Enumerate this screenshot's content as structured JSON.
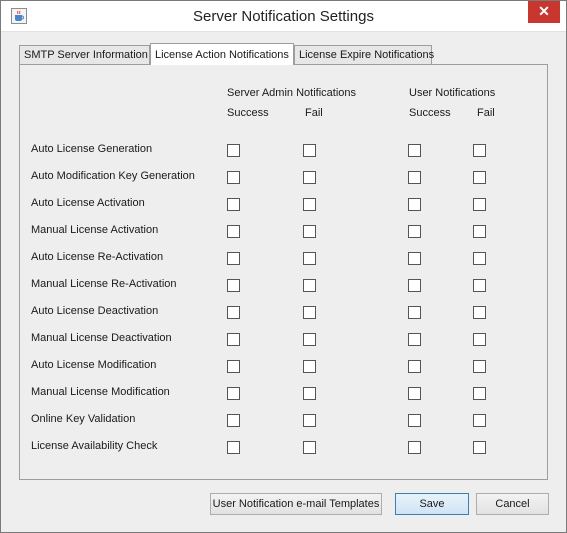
{
  "window": {
    "title": "Server Notification Settings",
    "close_symbol": "✕"
  },
  "tabs": [
    {
      "label": "SMTP Server Information",
      "active": false
    },
    {
      "label": "License Action Notifications",
      "active": true
    },
    {
      "label": "License Expire Notifications",
      "active": false
    }
  ],
  "groups": {
    "admin": {
      "title": "Server Admin Notifications",
      "success": "Success",
      "fail": "Fail"
    },
    "user": {
      "title": "User Notifications",
      "success": "Success",
      "fail": "Fail"
    }
  },
  "rows": [
    {
      "label": "Auto License Generation",
      "checks": [
        false,
        false,
        false,
        false
      ]
    },
    {
      "label": "Auto Modification Key Generation",
      "checks": [
        false,
        false,
        false,
        false
      ]
    },
    {
      "label": "Auto License Activation",
      "checks": [
        false,
        false,
        false,
        false
      ]
    },
    {
      "label": "Manual License Activation",
      "checks": [
        false,
        false,
        false,
        false
      ]
    },
    {
      "label": "Auto License Re-Activation",
      "checks": [
        false,
        false,
        false,
        false
      ]
    },
    {
      "label": "Manual License Re-Activation",
      "checks": [
        false,
        false,
        false,
        false
      ]
    },
    {
      "label": "Auto License Deactivation",
      "checks": [
        false,
        false,
        false,
        false
      ]
    },
    {
      "label": "Manual License Deactivation",
      "checks": [
        false,
        false,
        false,
        false
      ]
    },
    {
      "label": "Auto License Modification",
      "checks": [
        false,
        false,
        false,
        false
      ]
    },
    {
      "label": "Manual License Modification",
      "checks": [
        false,
        false,
        false,
        false
      ]
    },
    {
      "label": "Online Key Validation",
      "checks": [
        false,
        false,
        false,
        false
      ]
    },
    {
      "label": "License Availability Check",
      "checks": [
        false,
        false,
        false,
        false
      ]
    }
  ],
  "buttons": {
    "templates": "User Notification e-mail Templates",
    "save": "Save",
    "cancel": "Cancel"
  },
  "icons": {
    "app": "java-cup-icon",
    "close": "close-icon"
  }
}
